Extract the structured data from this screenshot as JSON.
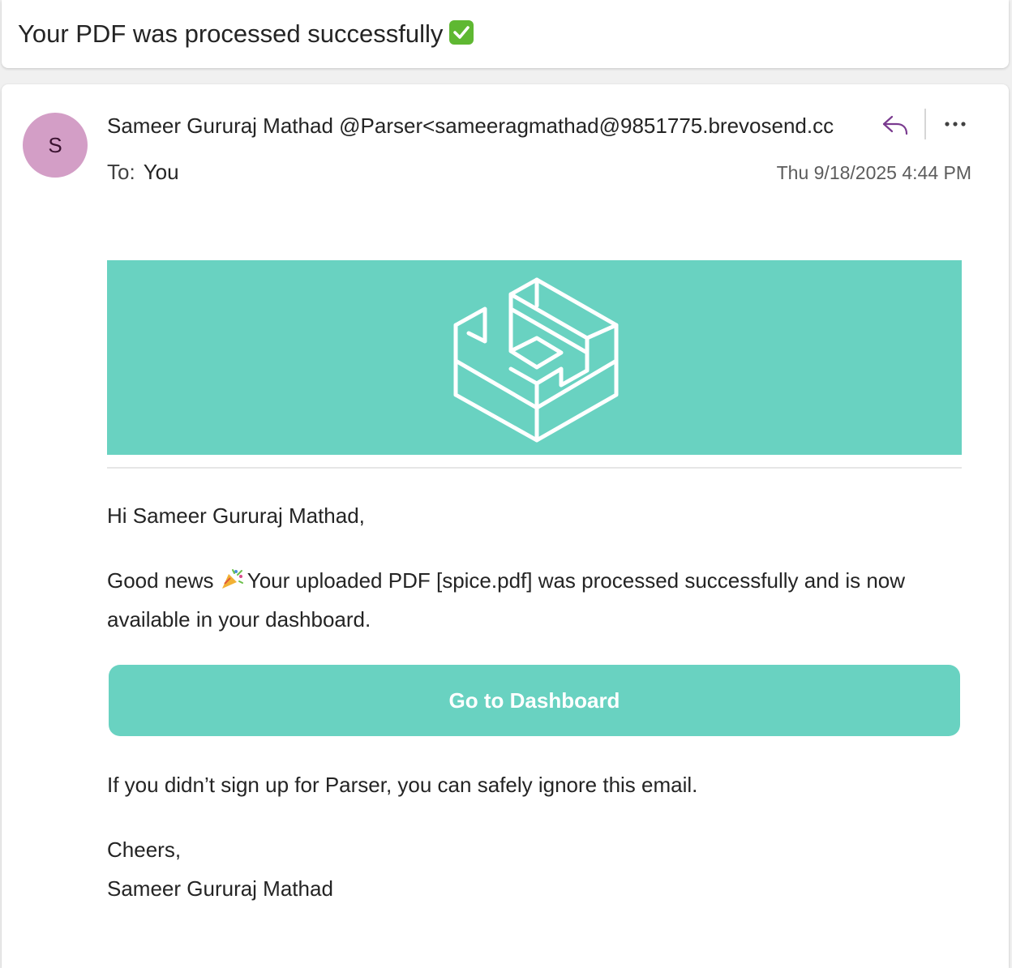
{
  "email": {
    "subject": "Your PDF was processed successfully",
    "subject_emoji": "check-mark-icon",
    "avatar_initial": "S",
    "avatar_color": "#d39ec6",
    "from": "Sameer Gururaj Mathad @Parser<sameeragmathad@9851775.brevosend.cc",
    "to_label": "To:",
    "to_value": "You",
    "timestamp": "Thu 9/18/2025 4:44 PM",
    "actions": {
      "reply_icon": "reply-icon",
      "more_icon": "more-icon"
    }
  },
  "message": {
    "banner_color": "#69d2c1",
    "banner_logo": "parser-logo-icon",
    "greeting": "Hi Sameer Gururaj Mathad,",
    "news_prefix": "Good news",
    "news_emoji": "party-popper-icon",
    "news_text": "Your uploaded PDF [spice.pdf] was processed successfully and is now available in your dashboard.",
    "cta_label": "Go to Dashboard",
    "ignore_note": "If you didn’t sign up for Parser, you can safely ignore this email.",
    "signoff": "Cheers,",
    "signature": "Sameer Gururaj Mathad"
  }
}
